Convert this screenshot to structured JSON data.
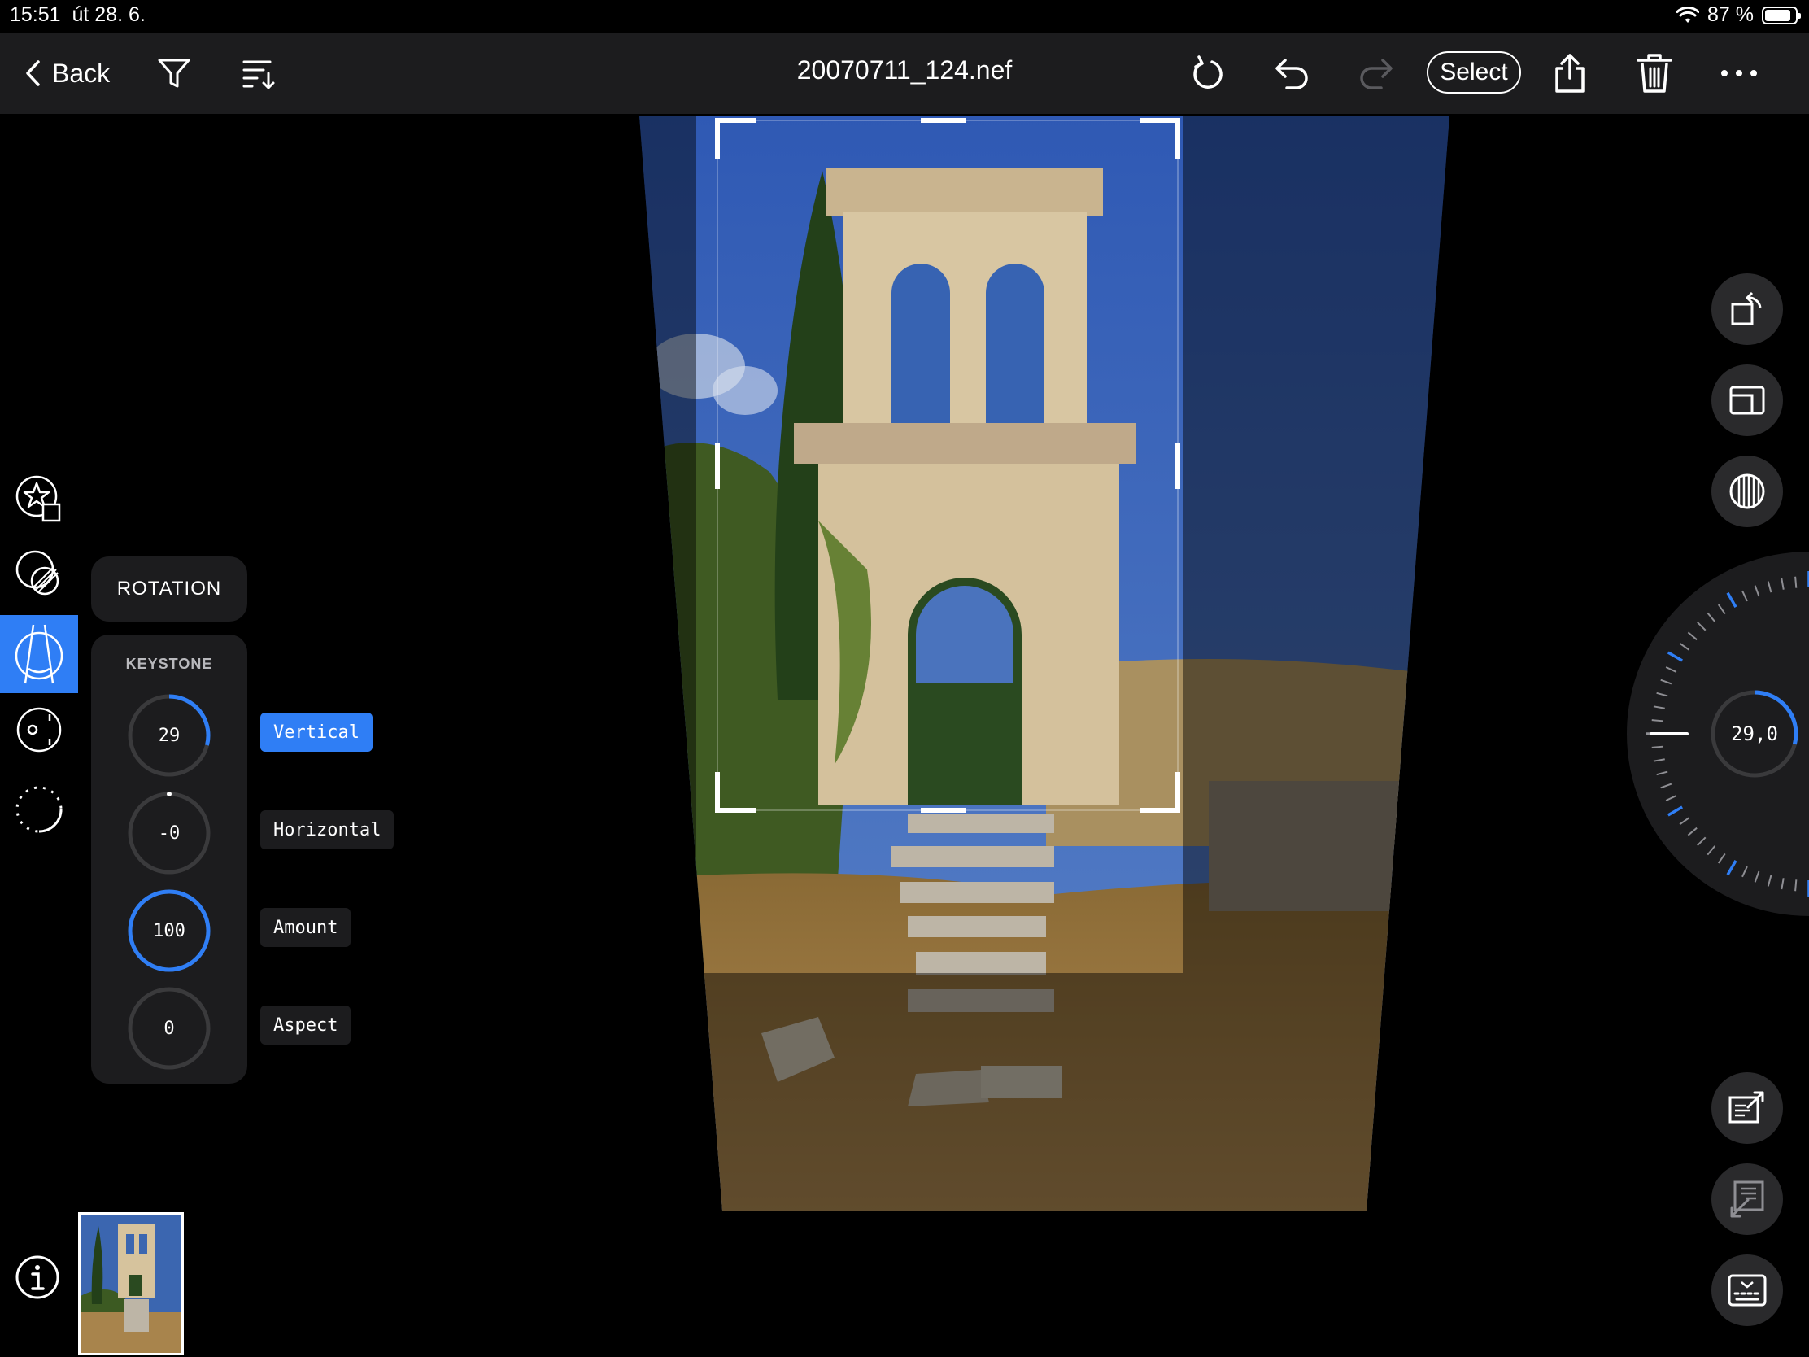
{
  "status_bar": {
    "time": "15:51",
    "date": "út 28. 6.",
    "battery_text": "87 %",
    "battery_level": 0.87
  },
  "toolbar": {
    "back_label": "Back",
    "title": "20070711_124.nef",
    "select_label": "Select",
    "icons": [
      "chevron-left-icon",
      "filter-icon",
      "sort-icon",
      "revert-icon",
      "undo-icon",
      "redo-icon",
      "share-icon",
      "trash-icon",
      "more-icon"
    ]
  },
  "left_rail": {
    "tools": [
      {
        "name": "presets-star-icon",
        "active": false
      },
      {
        "name": "mask-icon",
        "active": false
      },
      {
        "name": "geometry-keystone-icon",
        "active": true
      },
      {
        "name": "lens-icon",
        "active": false
      },
      {
        "name": "rotate-dashed-icon",
        "active": false
      }
    ]
  },
  "rotation_tab": {
    "label": "ROTATION"
  },
  "keystone": {
    "title": "KEYSTONE",
    "controls": [
      {
        "value": "29",
        "label": "Vertical",
        "active": true,
        "fraction": 0.29
      },
      {
        "value": "-0",
        "label": "Horizontal",
        "active": false,
        "fraction": 0
      },
      {
        "value": "100",
        "label": "Amount",
        "active": false,
        "fraction": 1.0
      },
      {
        "value": "0",
        "label": "Aspect",
        "active": false,
        "fraction": 0
      }
    ]
  },
  "rotation_wheel": {
    "value": "29,0",
    "fraction": 0.29
  },
  "right_buttons": [
    "rotate-crop-icon",
    "aspect-ratio-icon",
    "grid-overlay-icon"
  ],
  "bottom_right_buttons": [
    "export-icon",
    "import-icon",
    "keyboard-icon"
  ],
  "colors": {
    "accent": "#2f7ef5",
    "panel": "#1c1c1e",
    "toolbar": "#1c1c1e"
  }
}
